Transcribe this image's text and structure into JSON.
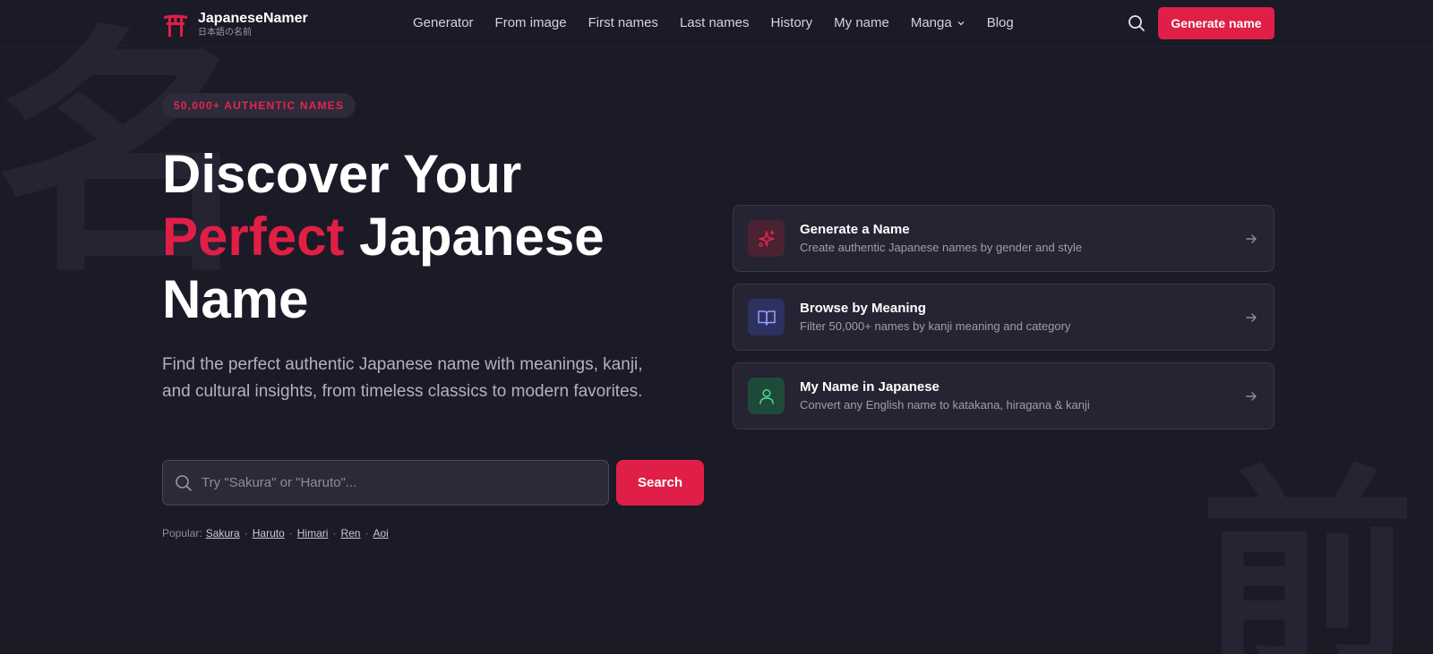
{
  "background": {
    "kanji_left": "名",
    "kanji_right": "前"
  },
  "nav": {
    "brand": "JapaneseNamer",
    "brand_sub": "日本語の名前",
    "links": [
      "Generator",
      "From image",
      "First names",
      "Last names",
      "History",
      "My name",
      "Manga",
      "Blog"
    ],
    "cta": "Generate name"
  },
  "hero": {
    "badge": "50,000+ AUTHENTIC NAMES",
    "headline_1": "Discover Your",
    "headline_accent": "Perfect",
    "headline_2": " Japanese",
    "headline_3": "Name",
    "lead": "Find the perfect authentic Japanese name with meanings, kanji, and cultural insights, from timeless classics to modern favorites.",
    "search_placeholder": "Try \"Sakura\" or \"Haruto\"...",
    "search_button": "Search",
    "popular_label": "Popular:",
    "popular": [
      "Sakura",
      "Haruto",
      "Himari",
      "Ren",
      "Aoi"
    ]
  },
  "cards": [
    {
      "title": "Generate a Name",
      "desc": "Create authentic Japanese names by gender and style",
      "icon": "sparkles-icon"
    },
    {
      "title": "Browse by Meaning",
      "desc": "Filter 50,000+ names by kanji meaning and category",
      "icon": "book-icon"
    },
    {
      "title": "My Name in Japanese",
      "desc": "Convert any English name to katakana, hiragana & kanji",
      "icon": "user-icon"
    }
  ],
  "colors": {
    "accent": "#df1f47",
    "background": "#1b1a27",
    "card": "#262433"
  }
}
